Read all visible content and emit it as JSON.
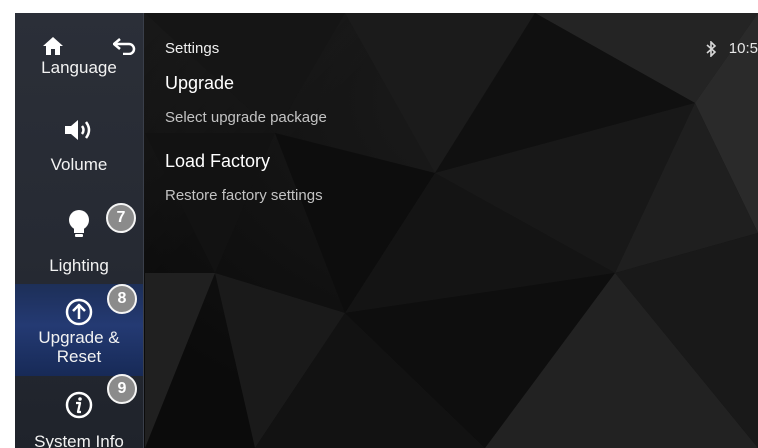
{
  "header": {
    "title": "Settings",
    "time": "10:5"
  },
  "sidebar": {
    "items": [
      {
        "label": "Language"
      },
      {
        "label": "Volume"
      },
      {
        "label": "Lighting",
        "badge": "7"
      },
      {
        "label": "Upgrade &",
        "label2": "Reset",
        "badge": "8"
      },
      {
        "label": "System Info",
        "badge": "9"
      }
    ]
  },
  "main": {
    "options": [
      {
        "title": "Upgrade",
        "subtitle": "Select upgrade package"
      },
      {
        "title": "Load Factory",
        "subtitle": "Restore factory settings"
      }
    ]
  },
  "colors": {
    "accent_selected": "#243a73",
    "sidebar_bg": "#2b2f38",
    "badge": "#8b8b8b"
  },
  "icons": [
    "home-icon",
    "back-icon",
    "speaker-icon",
    "bulb-icon",
    "upload-arrow-icon",
    "info-icon",
    "bluetooth-icon"
  ]
}
